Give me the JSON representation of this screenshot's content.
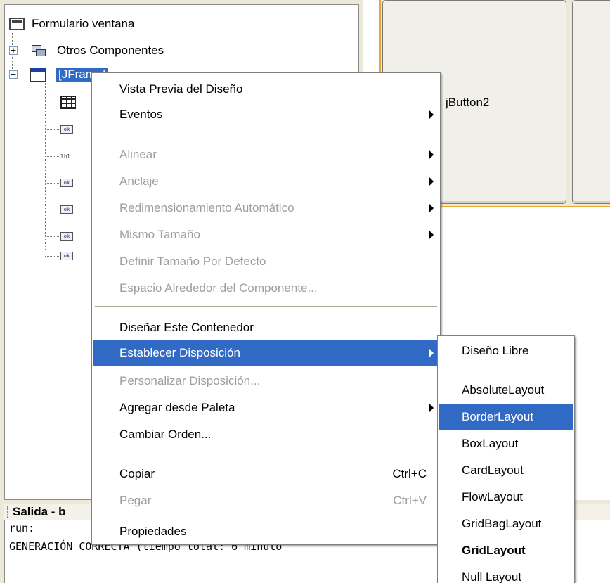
{
  "tree": {
    "root_label": "Formulario ventana",
    "other_components_label": "Otros Componentes",
    "frame_label": "[JFrame]",
    "frame_icon": "jframe-icon",
    "expand_glyph": "+",
    "collapse_glyph": "−",
    "child_icons": [
      "grid-layout-icon",
      "button-icon",
      "label-icon",
      "button-icon",
      "button-icon",
      "button-icon",
      "button-icon"
    ]
  },
  "design": {
    "button_label": "jButton2",
    "accent_color": "#e8a537"
  },
  "output": {
    "title": "Salida - b",
    "lines": [
      "run:",
      "GENERACIÓN CORRECTA (tiempo total: 6 minuto"
    ]
  },
  "context_menu": {
    "items": [
      {
        "label": "Vista Previa del Diseño",
        "enabled": true
      },
      {
        "label": "Eventos",
        "enabled": true,
        "submenu": true
      },
      {
        "label": "Alinear",
        "enabled": false,
        "submenu": true
      },
      {
        "label": "Anclaje",
        "enabled": false,
        "submenu": true
      },
      {
        "label": "Redimensionamiento Automático",
        "enabled": false,
        "submenu": true
      },
      {
        "label": "Mismo Tamaño",
        "enabled": false,
        "submenu": true
      },
      {
        "label": "Definir Tamaño Por Defecto",
        "enabled": false
      },
      {
        "label": "Espacio Alrededor del Componente...",
        "enabled": false
      },
      {
        "label": "Diseñar Este Contenedor",
        "enabled": true
      },
      {
        "label": "Establecer Disposición",
        "enabled": true,
        "submenu": true,
        "highlighted": true
      },
      {
        "label": "Personalizar Disposición...",
        "enabled": false
      },
      {
        "label": "Agregar desde Paleta",
        "enabled": true,
        "submenu": true
      },
      {
        "label": "Cambiar Orden...",
        "enabled": true
      },
      {
        "label": "Copiar",
        "enabled": true,
        "shortcut": "Ctrl+C"
      },
      {
        "label": "Pegar",
        "enabled": false,
        "shortcut": "Ctrl+V"
      },
      {
        "label": "Propiedades",
        "enabled": true
      }
    ],
    "highlight_color": "#316ac5",
    "disabled_color": "#9e9e9e"
  },
  "layout_submenu": {
    "items": [
      {
        "label": "Diseño Libre"
      },
      {
        "label": "AbsoluteLayout"
      },
      {
        "label": "BorderLayout",
        "highlighted": true
      },
      {
        "label": "BoxLayout"
      },
      {
        "label": "CardLayout"
      },
      {
        "label": "FlowLayout"
      },
      {
        "label": "GridBagLayout"
      },
      {
        "label": "GridLayout",
        "bold": true
      },
      {
        "label": "Null Layout"
      }
    ]
  }
}
